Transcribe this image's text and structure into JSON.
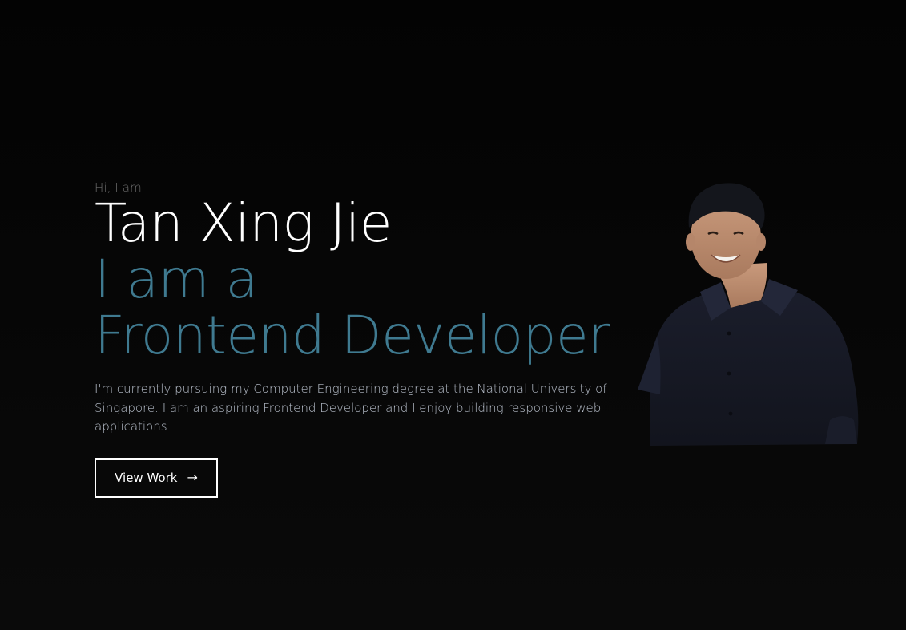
{
  "hero": {
    "greeting": "Hi, I am",
    "name": "Tan Xing Jie",
    "role_line_1": "I am a",
    "role_line_2": "Frontend Developer",
    "bio": "I'm currently pursuing my Computer Engineering degree at the National University of Singapore. I am an aspiring Frontend Developer and I enjoy building responsive web applications.",
    "cta_label": "View Work",
    "cta_icon": "arrow-right-icon",
    "cta_arrow": "→"
  },
  "colors": {
    "background": "#0a0a0a",
    "accent": "#3f7a90",
    "greeting": "#6d6d6d",
    "body_text": "#b9c0cc"
  },
  "portrait": {
    "icon": "portrait-photo"
  }
}
